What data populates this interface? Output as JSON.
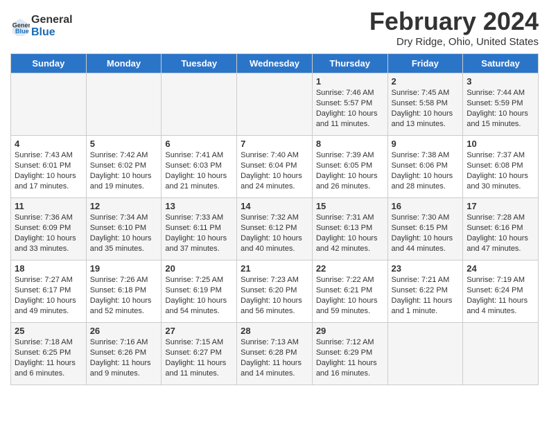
{
  "header": {
    "logo_line1": "General",
    "logo_line2": "Blue",
    "title": "February 2024",
    "subtitle": "Dry Ridge, Ohio, United States"
  },
  "days_of_week": [
    "Sunday",
    "Monday",
    "Tuesday",
    "Wednesday",
    "Thursday",
    "Friday",
    "Saturday"
  ],
  "weeks": [
    [
      {
        "day": "",
        "info": ""
      },
      {
        "day": "",
        "info": ""
      },
      {
        "day": "",
        "info": ""
      },
      {
        "day": "",
        "info": ""
      },
      {
        "day": "1",
        "info": "Sunrise: 7:46 AM\nSunset: 5:57 PM\nDaylight: 10 hours\nand 11 minutes."
      },
      {
        "day": "2",
        "info": "Sunrise: 7:45 AM\nSunset: 5:58 PM\nDaylight: 10 hours\nand 13 minutes."
      },
      {
        "day": "3",
        "info": "Sunrise: 7:44 AM\nSunset: 5:59 PM\nDaylight: 10 hours\nand 15 minutes."
      }
    ],
    [
      {
        "day": "4",
        "info": "Sunrise: 7:43 AM\nSunset: 6:01 PM\nDaylight: 10 hours\nand 17 minutes."
      },
      {
        "day": "5",
        "info": "Sunrise: 7:42 AM\nSunset: 6:02 PM\nDaylight: 10 hours\nand 19 minutes."
      },
      {
        "day": "6",
        "info": "Sunrise: 7:41 AM\nSunset: 6:03 PM\nDaylight: 10 hours\nand 21 minutes."
      },
      {
        "day": "7",
        "info": "Sunrise: 7:40 AM\nSunset: 6:04 PM\nDaylight: 10 hours\nand 24 minutes."
      },
      {
        "day": "8",
        "info": "Sunrise: 7:39 AM\nSunset: 6:05 PM\nDaylight: 10 hours\nand 26 minutes."
      },
      {
        "day": "9",
        "info": "Sunrise: 7:38 AM\nSunset: 6:06 PM\nDaylight: 10 hours\nand 28 minutes."
      },
      {
        "day": "10",
        "info": "Sunrise: 7:37 AM\nSunset: 6:08 PM\nDaylight: 10 hours\nand 30 minutes."
      }
    ],
    [
      {
        "day": "11",
        "info": "Sunrise: 7:36 AM\nSunset: 6:09 PM\nDaylight: 10 hours\nand 33 minutes."
      },
      {
        "day": "12",
        "info": "Sunrise: 7:34 AM\nSunset: 6:10 PM\nDaylight: 10 hours\nand 35 minutes."
      },
      {
        "day": "13",
        "info": "Sunrise: 7:33 AM\nSunset: 6:11 PM\nDaylight: 10 hours\nand 37 minutes."
      },
      {
        "day": "14",
        "info": "Sunrise: 7:32 AM\nSunset: 6:12 PM\nDaylight: 10 hours\nand 40 minutes."
      },
      {
        "day": "15",
        "info": "Sunrise: 7:31 AM\nSunset: 6:13 PM\nDaylight: 10 hours\nand 42 minutes."
      },
      {
        "day": "16",
        "info": "Sunrise: 7:30 AM\nSunset: 6:15 PM\nDaylight: 10 hours\nand 44 minutes."
      },
      {
        "day": "17",
        "info": "Sunrise: 7:28 AM\nSunset: 6:16 PM\nDaylight: 10 hours\nand 47 minutes."
      }
    ],
    [
      {
        "day": "18",
        "info": "Sunrise: 7:27 AM\nSunset: 6:17 PM\nDaylight: 10 hours\nand 49 minutes."
      },
      {
        "day": "19",
        "info": "Sunrise: 7:26 AM\nSunset: 6:18 PM\nDaylight: 10 hours\nand 52 minutes."
      },
      {
        "day": "20",
        "info": "Sunrise: 7:25 AM\nSunset: 6:19 PM\nDaylight: 10 hours\nand 54 minutes."
      },
      {
        "day": "21",
        "info": "Sunrise: 7:23 AM\nSunset: 6:20 PM\nDaylight: 10 hours\nand 56 minutes."
      },
      {
        "day": "22",
        "info": "Sunrise: 7:22 AM\nSunset: 6:21 PM\nDaylight: 10 hours\nand 59 minutes."
      },
      {
        "day": "23",
        "info": "Sunrise: 7:21 AM\nSunset: 6:22 PM\nDaylight: 11 hours\nand 1 minute."
      },
      {
        "day": "24",
        "info": "Sunrise: 7:19 AM\nSunset: 6:24 PM\nDaylight: 11 hours\nand 4 minutes."
      }
    ],
    [
      {
        "day": "25",
        "info": "Sunrise: 7:18 AM\nSunset: 6:25 PM\nDaylight: 11 hours\nand 6 minutes."
      },
      {
        "day": "26",
        "info": "Sunrise: 7:16 AM\nSunset: 6:26 PM\nDaylight: 11 hours\nand 9 minutes."
      },
      {
        "day": "27",
        "info": "Sunrise: 7:15 AM\nSunset: 6:27 PM\nDaylight: 11 hours\nand 11 minutes."
      },
      {
        "day": "28",
        "info": "Sunrise: 7:13 AM\nSunset: 6:28 PM\nDaylight: 11 hours\nand 14 minutes."
      },
      {
        "day": "29",
        "info": "Sunrise: 7:12 AM\nSunset: 6:29 PM\nDaylight: 11 hours\nand 16 minutes."
      },
      {
        "day": "",
        "info": ""
      },
      {
        "day": "",
        "info": ""
      }
    ]
  ]
}
